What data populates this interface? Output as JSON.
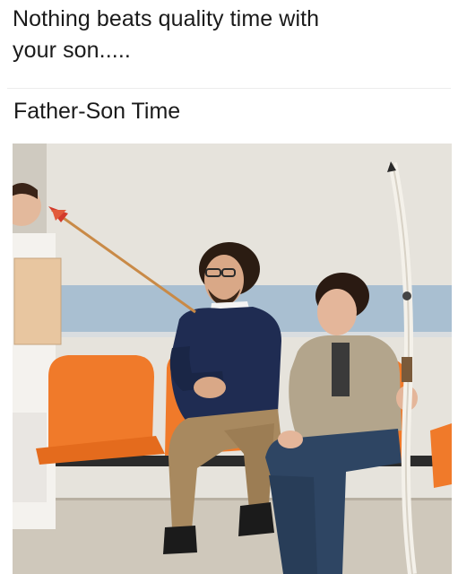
{
  "caption": {
    "line1": "Nothing beats quality time with",
    "line2": "your son....."
  },
  "post_title": "Father-Son Time",
  "photo": {
    "subject": "man-and-boy-in-waiting-room-with-arrow-and-bow",
    "colors": {
      "wall": "#e6e3dc",
      "stripe": "#a9bfd1",
      "floor": "#cfc8bb",
      "chair": "#f07a2a",
      "sweater": "#1f2c52",
      "khaki": "#a8895f",
      "jeans": "#2e4563",
      "hoodie": "#b3a58c",
      "bow": "#f4f1ea"
    }
  }
}
